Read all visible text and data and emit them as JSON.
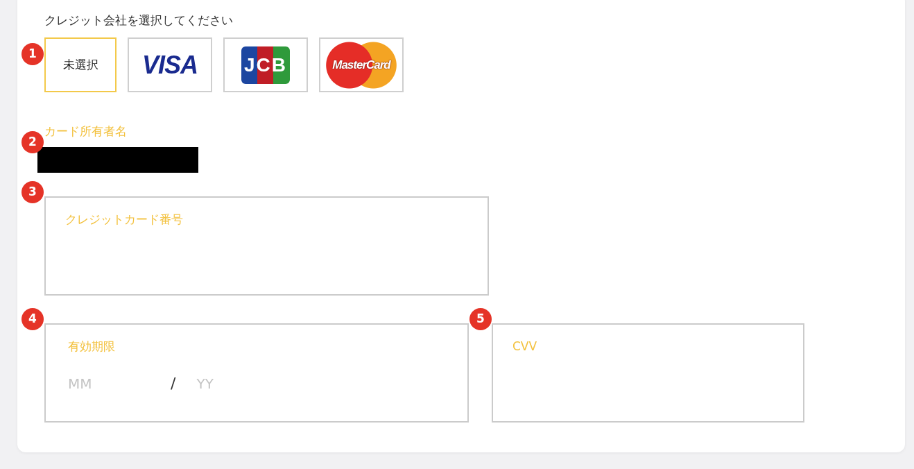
{
  "brand_section": {
    "step": "1",
    "label": "クレジット会社を選択してください",
    "options": [
      {
        "kind": "text",
        "label": "未選択",
        "selected": true
      },
      {
        "kind": "visa",
        "label": "VISA",
        "selected": false
      },
      {
        "kind": "jcb",
        "label": "JCB",
        "selected": false
      },
      {
        "kind": "mastercard",
        "label": "MasterCard",
        "selected": false
      }
    ]
  },
  "cardholder": {
    "step": "2",
    "label": "カード所有者名",
    "redacted": true
  },
  "card_number": {
    "step": "3",
    "label": "クレジットカード番号"
  },
  "expiry": {
    "step": "4",
    "label": "有効期限",
    "month_placeholder": "MM",
    "separator": "/",
    "year_placeholder": "YY"
  },
  "cvv": {
    "step": "5",
    "label": "CVV"
  }
}
